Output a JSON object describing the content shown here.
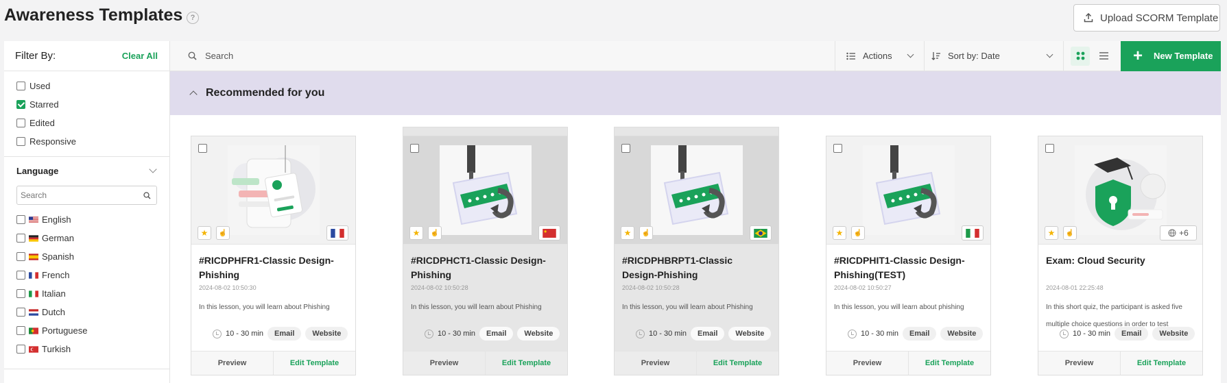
{
  "header": {
    "title": "Awareness Templates",
    "help": "?",
    "upload_label": "Upload SCORM Template"
  },
  "sidebar": {
    "filter_title": "Filter By:",
    "clear_all": "Clear All",
    "filters": [
      {
        "label": "Used",
        "checked": false
      },
      {
        "label": "Starred",
        "checked": true
      },
      {
        "label": "Edited",
        "checked": false
      },
      {
        "label": "Responsive",
        "checked": false
      }
    ],
    "language_title": "Language",
    "language_search_placeholder": "Search",
    "languages": [
      {
        "label": "English",
        "flag": "us"
      },
      {
        "label": "German",
        "flag": "de"
      },
      {
        "label": "Spanish",
        "flag": "es"
      },
      {
        "label": "French",
        "flag": "fr"
      },
      {
        "label": "Italian",
        "flag": "it"
      },
      {
        "label": "Dutch",
        "flag": "nl"
      },
      {
        "label": "Portuguese",
        "flag": "pt"
      },
      {
        "label": "Turkish",
        "flag": "tr"
      }
    ]
  },
  "toolbar": {
    "search_placeholder": "Search",
    "actions_label": "Actions",
    "sort_label": "Sort by: Date",
    "new_template_label": "New Template"
  },
  "recommended": {
    "title": "Recommended for you"
  },
  "cards": [
    {
      "title": "#RICDPHFR1-Classic Design-Phishing",
      "date": "2024-08-02 10:50:30",
      "description": "In this lesson, you will learn about Phishing",
      "duration": "10 - 30 min",
      "tags": [
        "Email",
        "Website"
      ],
      "flag": "fr",
      "image": "phone-hook",
      "hovered": false,
      "preview": "Preview",
      "edit": "Edit Template"
    },
    {
      "title": "#RICDPHCT1-Classic Design-Phishing",
      "date": "2024-08-02 10:50:28",
      "description": "In this lesson, you will learn about Phishing",
      "duration": "10 - 30 min",
      "tags": [
        "Email",
        "Website"
      ],
      "flag": "cn",
      "image": "password-hook",
      "hovered": true,
      "preview": "Preview",
      "edit": "Edit Template"
    },
    {
      "title": "#RICDPHBRPT1-Classic Design-Phishing",
      "date": "2024-08-02 10:50:28",
      "description": "In this lesson, you will learn about Phishing",
      "duration": "10 - 30 min",
      "tags": [
        "Email",
        "Website"
      ],
      "flag": "br",
      "image": "password-hook",
      "hovered": true,
      "preview": "Preview",
      "edit": "Edit Template"
    },
    {
      "title": "#RICDPHIT1-Classic Design-Phishing(TEST)",
      "date": "2024-08-02 10:50:27",
      "description": "In this lesson, you will learn about phishing",
      "duration": "10 - 30 min",
      "tags": [
        "Email",
        "Website"
      ],
      "flag": "it",
      "image": "password-hook",
      "hovered": false,
      "preview": "Preview",
      "edit": "Edit Template"
    },
    {
      "title": "Exam: Cloud Security",
      "date": "2024-08-01 22:25:48",
      "description": "In this short quiz, the participant is asked five multiple choice questions in order to test",
      "duration": "10 - 30 min",
      "tags": [
        "Email",
        "Website"
      ],
      "lang_count": "+6",
      "image": "shield-cap",
      "hovered": false,
      "preview": "Preview",
      "edit": "Edit Template"
    }
  ],
  "colors": {
    "accent": "#1aa25a",
    "banner": "#e0dced"
  }
}
